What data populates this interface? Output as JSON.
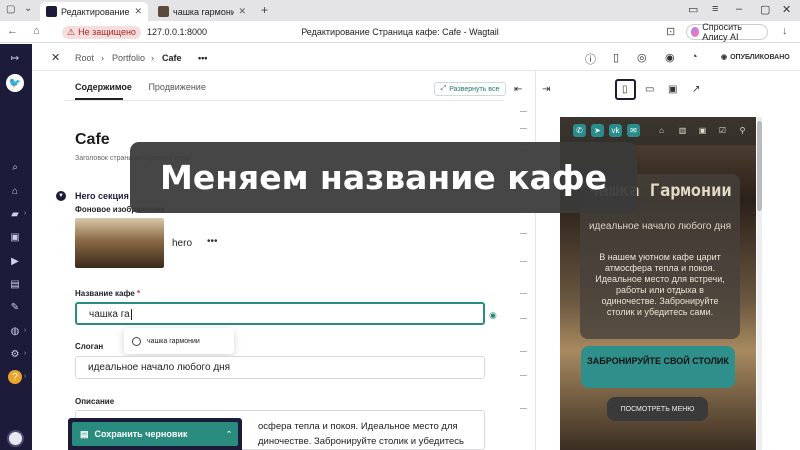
{
  "browser": {
    "tabs": [
      {
        "title": "Редактирование Стра",
        "active": true
      },
      {
        "title": "чашка гармонии",
        "active": false
      }
    ],
    "new_tab": "+",
    "insecure_label": "Не защищено",
    "url": "127.0.0.1:8000",
    "page_title": "Редактирование Страница кафе: Cafe - Wagtail",
    "alice_label": "Спросить Алису AI"
  },
  "header": {
    "breadcrumbs": [
      "Root",
      "Portfolio",
      "Cafe"
    ],
    "more": "•••",
    "status": "ОПУБЛИКОВАНО"
  },
  "tabs": {
    "content": "Содержимое",
    "promotion": "Продвижение"
  },
  "expand_label": "Развернуть все",
  "form": {
    "page_title": "Cafe",
    "page_title_help": "Заголовок страницы видимый всем",
    "section_title": "Hero секция",
    "bg_image_label": "Фоновое изображение",
    "image_name": "hero",
    "image_more": "•••",
    "cafe_name_label": "Название кафе",
    "required_mark": "*",
    "cafe_name_value": "чашка га",
    "suggestion": "чашка гармонии",
    "slogan_label": "Слоган",
    "slogan_value": "идеальное начало любого дня",
    "description_label": "Описание",
    "description_line1": "осфера тепла и покоя. Идеальное место для",
    "description_line2": "диночестве. Забронируйте столик и убедитесь"
  },
  "save_label": "Сохранить черновик",
  "preview": {
    "title": "Чашка Гармонии",
    "subtitle": "идеальное начало любого дня",
    "description": "В нашем уютном кафе царит атмосфера тепла и покоя. Идеальное место для встречи, работы или отдыха в одиночестве. Забронируйте столик и убедитесь сами.",
    "book_button": "ЗАБРОНИРУЙТЕ СВОЙ СТОЛИК",
    "menu_button": "ПОСМОТРЕТЬ МЕНЮ"
  },
  "overlay_caption": "Меняем название кафе",
  "colors": {
    "sidebar": "#1d1b3a",
    "accent": "#2a8c7e",
    "overlay": "#3a3a3a"
  }
}
